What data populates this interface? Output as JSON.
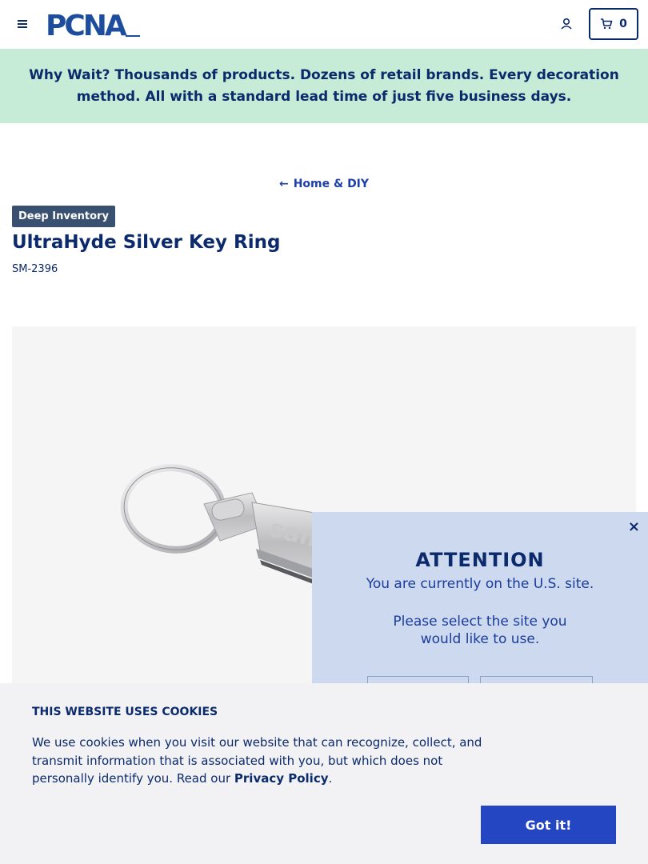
{
  "header": {
    "logo_text": "PCNA",
    "cart_count": "0"
  },
  "banner": {
    "lead": "Why Wait?",
    "message": " Thousands of products. Dozens of retail brands. Every decoration method. All with a standard lead time of just five business days."
  },
  "breadcrumb": {
    "arrow": "←",
    "label": "Home & DIY"
  },
  "product": {
    "badge": "Deep Inventory",
    "title": "UltraHyde Silver Key Ring",
    "sku": "SM-2396",
    "image_label": "sam"
  },
  "modal": {
    "close": "×",
    "heading": "ATTENTION",
    "current_site": "You are currently on the U.S. site.",
    "select_prompt": "Please select the site you would like to use."
  },
  "cookie": {
    "heading": "THIS WEBSITE USES COOKIES",
    "body": "We use cookies when you visit our website that can recognize, collect, and transmit information that is associated with you, but which does not personally identify you. Read our ",
    "link": "Privacy Policy",
    "period": ".",
    "button": "Got it!"
  },
  "colors": {
    "navy": "#0b2a6b",
    "banner_bg": "#c6ebd6",
    "accent": "#2446c3"
  }
}
